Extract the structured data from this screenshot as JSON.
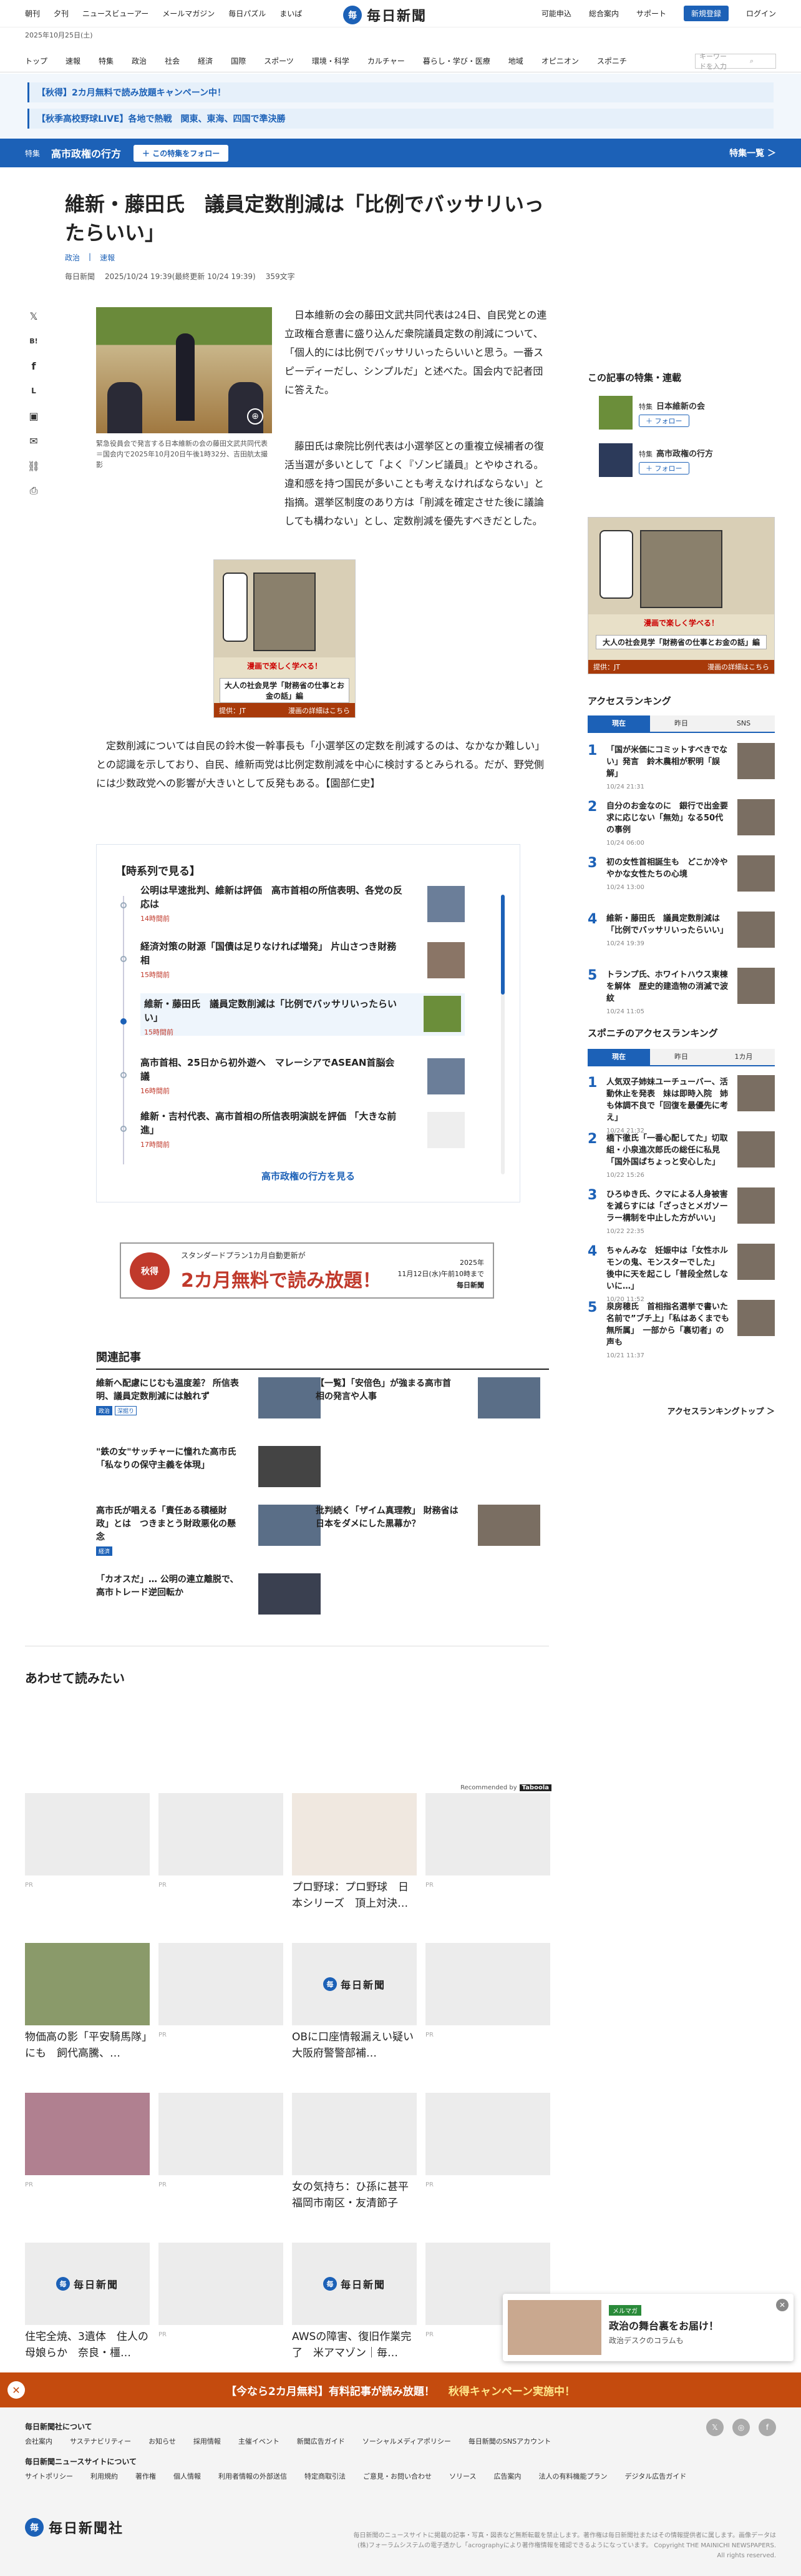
{
  "util": {
    "left": [
      "朝刊",
      "夕刊",
      "ニュースビューアー",
      "メールマガジン",
      "毎日パズル",
      "まいぱ"
    ],
    "right": [
      "可能申込",
      "総合案内",
      "サポート"
    ],
    "register": "新規登録",
    "login": "ログイン",
    "date": "2025年10月25日(土)"
  },
  "logo": {
    "mark": "毎",
    "text": "毎日新聞",
    "foot_text": "毎日新聞社"
  },
  "nav": {
    "items": [
      "トップ",
      "速報",
      "特集",
      "政治",
      "社会",
      "経済",
      "国際",
      "スポーツ",
      "環境・科学",
      "カルチャー",
      "暮らし・学び・医療",
      "地域",
      "オピニオン",
      "スポニチ"
    ],
    "search_placeholder": "キーワードを入力"
  },
  "promos": [
    "【秋得】2カ月無料で読み放題キャンペーン中！",
    "【秋季高校野球LIVE】各地で熱戦　関東、東海、四国で準決勝"
  ],
  "feature": {
    "tag": "特集",
    "title": "高市政権の行方",
    "follow": "＋ この特集をフォロー",
    "list": "特集一覧 ＞"
  },
  "article": {
    "title": "維新・藤田氏　議員定数削減は「比例でバッサリいったらいい」",
    "tags": [
      "政治",
      "速報"
    ],
    "meta": [
      "毎日新聞",
      "2025/10/24 19:39(最終更新 10/24 19:39)",
      "359文字"
    ],
    "caption": "緊急役員会で発言する日本維新の会の藤田文武共同代表＝国会内で2025年10月20日午後1時32分、吉田航太撮影",
    "p1": "　日本維新の会の藤田文武共同代表は24日、自民党との連立政権合意書に盛り込んだ衆院議員定数の削減について、「個人的には比例でバッサリいったらいいと思う。一番スピーディーだし、シンプルだ」と述べた。国会内で記者団に答えた。",
    "p2": "　藤田氏は衆院比例代表は小選挙区との重複立候補者の復活当選が多いとして「よく『ゾンビ議員』とやゆされる。違和感を持つ国民が多いことも考えなければならない」と指摘。選挙区制度のあり方は「削減を確定させた後に議論しても構わない」とし、定数削減を優先すべきだとした。",
    "p3": "　定数削減については自民の鈴木俊一幹事長も「小選挙区の定数を削減するのは、なかなか難しい」との認識を示しており、自民、維新両党は比例定数削減を中心に検討するとみられる。だが、野党側には少数政党への影響が大きいとして反発もある。【園部仁史】"
  },
  "share": {
    "icons": [
      "x-icon",
      "hatena-icon",
      "facebook-icon",
      "line-icon",
      "copy-icon",
      "mail-icon",
      "link-icon",
      "print-icon"
    ],
    "glyphs": [
      "𝕏",
      "B!",
      "f",
      "L",
      "▣",
      "✉",
      "⛓",
      "⎙"
    ]
  },
  "ad": {
    "s1": "漫画で楽しく学べる！",
    "s2": "大人の社会見学「財務省の仕事とお金の話」編",
    "s3a": "提供：JT",
    "s3b": "漫画の詳細はこちら"
  },
  "timeline": {
    "heading": "【時系列で見る】",
    "more": "高市政権の行方を見る",
    "items": [
      {
        "title": "公明は早速批判、維新は評価　高市首相の所信表明、各党の反応は",
        "date": "14時間前"
      },
      {
        "title": "経済対策の財源「国債は足りなければ増発」 片山さつき財務相",
        "date": "15時間前"
      },
      {
        "title": "維新・藤田氏　議員定数削減は「比例でバッサリいったらいい」",
        "date": "15時間前"
      },
      {
        "title": "高市首相、25日から初外遊へ　マレーシアでASEAN首脳会議",
        "date": "16時間前"
      },
      {
        "title": "維新・吉村代表、高市首相の所信表明演説を評価 「大きな前進」",
        "date": "17時間前"
      }
    ]
  },
  "campaign": {
    "badge": "秋得",
    "top": "スタンダードプラン1カ月自動更新が",
    "big": "2カ月無料で読み放題！",
    "r1": "2025年",
    "r2": "11月12日(水)午前10時まで",
    "r3": "毎日新聞"
  },
  "related": {
    "heading": "関連記事",
    "items": [
      {
        "title": "維新へ配慮にじむも温度差？ 所信表明、議員定数削減には触れず",
        "badge": "政治",
        "badge2": "深掘り"
      },
      {
        "title": "【一覧】「安倍色」が強まる高市首相の発言や人事",
        "badge": "",
        "badge2": ""
      },
      {
        "title": "\"鉄の女\"サッチャーに憧れた高市氏 「私なりの保守主義を体現」",
        "badge": "",
        "badge2": ""
      },
      {
        "title": "高市氏が唱える「責任ある積極財政」とは　つきまとう財政悪化の懸念",
        "badge": "経済",
        "badge2": ""
      },
      {
        "title": "批判続く「ザイム真理教」 財務省は日本をダメにした黒幕か？",
        "badge": "",
        "badge2": ""
      },
      {
        "title": "「カオスだ」… 公明の連立離脱で、高市トレード逆回転か",
        "badge": "",
        "badge2": ""
      }
    ]
  },
  "awase": {
    "heading": "あわせて読みたい",
    "recommended": "Recommended by",
    "taboola": "Taboola",
    "pr": "PR",
    "tiles": [
      "",
      "",
      "プロ野球：プロ野球　日本シリーズ　頂上対決…",
      "",
      "物価高の影「平安騎馬隊」にも　飼代高騰、…",
      "",
      "OBに口座情報漏えい疑い　大阪府警警部補…",
      "",
      "",
      "",
      "女の気持ち：ひ孫に甚平　福岡市南区・友清節子",
      "",
      "住宅全焼、3遺体　住人の母娘らか　奈良・橿…",
      "",
      "AWSの障害、復旧作業完了　米アマゾン｜毎…",
      ""
    ]
  },
  "sidebar": {
    "series_heading": "この記事の特集・連載",
    "series": [
      {
        "kind": "特集",
        "title": "日本維新の会",
        "follow": "＋ フォロー"
      },
      {
        "kind": "特集",
        "title": "高市政権の行方",
        "follow": "＋ フォロー"
      }
    ],
    "rank_heading": "アクセスランキング",
    "rank_tabs": [
      "現在",
      "昨日",
      "SNS"
    ],
    "ranking": [
      {
        "t": "「国が米価にコミットすべきでない」発言　鈴木農相が釈明「誤解」",
        "d": "10/24 21:31"
      },
      {
        "t": "自分のお金なのに　銀行で出金要求に応じない「無効」なる50代の事例",
        "d": "10/24 06:00"
      },
      {
        "t": "初の女性首相誕生も　どこか冷ややかな女性たちの心境",
        "d": "10/24 13:00"
      },
      {
        "t": "維新・藤田氏　議員定数削減は「比例でバッサリいったらいい」",
        "d": "10/24 19:39"
      },
      {
        "t": "トランプ氏、ホワイトハウス東棟を解体　歴史的建造物の消滅で波紋",
        "d": "10/24 11:05"
      }
    ],
    "sponichi_heading": "スポニチのアクセスランキング",
    "sp_tabs": [
      "現在",
      "昨日",
      "1カ月"
    ],
    "sponichi": [
      {
        "t": "人気双子姉妹ユーチューバー、活動休止を発表　妹は即時入院　姉も体調不良で「回復を最優先に考え」",
        "d": "10/24 21:32"
      },
      {
        "t": "橋下徹氏「一番心配してた」切取組・小泉進次郎氏の総任に私見「国外国ばちょっと安心した」",
        "d": "10/22 15:26"
      },
      {
        "t": "ひろゆき氏、クマによる人身被害を減らすには「ざっさとメガソーラー構制を中止した方がいい」",
        "d": "10/22 22:35"
      },
      {
        "t": "ちゃんみな　妊娠中は「女性ホルモンの鬼、モンスターでした」　後中に天を起こし「普段全然しないに…」",
        "d": "10/20 11:52"
      },
      {
        "t": "泉房穂氏　首相指名選挙で書いた名前で”ブチ上」「私はあくまでも無所属」　一部から「裏切者」の声も",
        "d": "10/21 11:37"
      }
    ],
    "rank_more": "アクセスランキングトップ ＞"
  },
  "notif": {
    "badge": "メルマガ",
    "title": "政治の舞台裏をお届け！",
    "sub": "政治デスクのコラムも"
  },
  "bottom": {
    "main": "【今なら2カ月無料】有料記事が読み放題！",
    "sub": "秋得キャンペーン実施中！"
  },
  "footer": {
    "h1": "毎日新聞社について",
    "row1": [
      "会社案内",
      "サステナビリティー",
      "お知らせ",
      "採用情報",
      "主催イベント",
      "新聞広告ガイド",
      "ソーシャルメディアポリシー",
      "毎日新聞のSNSアカウント"
    ],
    "h2": "毎日新聞ニュースサイトについて",
    "row2": [
      "サイトポリシー",
      "利用規約",
      "著作権",
      "個人情報",
      "利用者情報の外部送信",
      "特定商取引法",
      "ご意見・お問い合わせ",
      "ソリース",
      "広告案内",
      "法人の有料機能プラン",
      "デジタル広告ガイド"
    ],
    "copy": "毎日新聞のニュースサイトに掲載の記事・写真・図表など無断転載を禁止します。著作権は毎日新聞社またはその情報提供者に属します。画像データは(株)フォーラムシステムの電子透かし「acrographyにより著作権情報を確認できるようになっています。 Copyright THE MAINICHI NEWSPAPERS. All rights reserved.",
    "social": [
      "𝕏",
      "◎",
      "f"
    ]
  }
}
